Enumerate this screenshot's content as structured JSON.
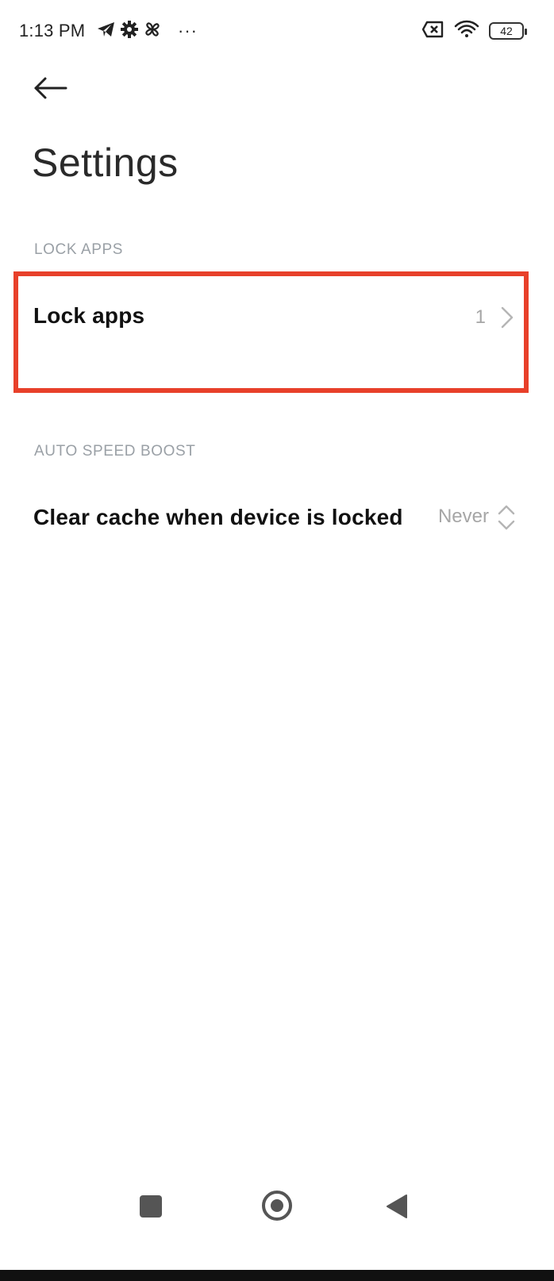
{
  "status_bar": {
    "time": "1:13 PM",
    "left_icons": [
      "telegram-icon",
      "gear-icon",
      "pinwheel-icon"
    ],
    "more": "···",
    "right_icons": [
      "no-sim-icon",
      "wifi-icon"
    ],
    "battery": "42"
  },
  "header": {
    "back_icon": "arrow-left-icon",
    "title": "Settings"
  },
  "sections": [
    {
      "header": "LOCK APPS",
      "items": [
        {
          "title": "Lock apps",
          "value": "1",
          "icon": "chevron-right-icon"
        }
      ]
    },
    {
      "header": "AUTO SPEED BOOST",
      "items": [
        {
          "title": "Clear cache when device is locked",
          "value": "Never",
          "icon": "chevron-up-down-icon"
        }
      ]
    }
  ],
  "highlight_color": "#e8402a",
  "nav_bar": {
    "icons": [
      "recents-square-icon",
      "home-circle-icon",
      "back-triangle-icon"
    ]
  }
}
